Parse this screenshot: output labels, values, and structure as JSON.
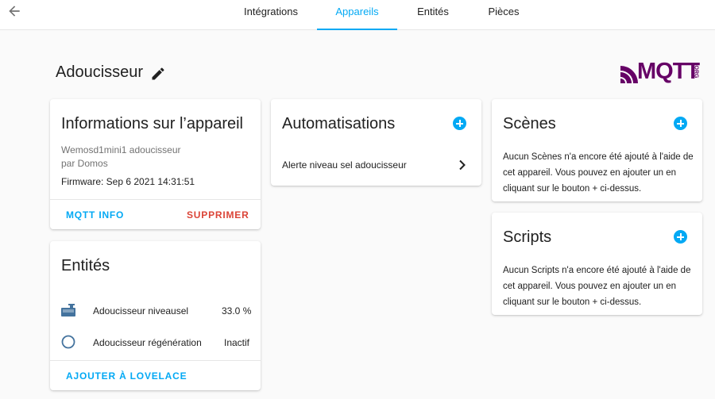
{
  "nav": {
    "back_icon": "arrow-left-icon",
    "tabs": [
      {
        "label": "Intégrations",
        "active": false
      },
      {
        "label": "Appareils",
        "active": true
      },
      {
        "label": "Entités",
        "active": false
      },
      {
        "label": "Pièces",
        "active": false
      }
    ]
  },
  "header": {
    "title": "Adoucisseur",
    "edit_icon": "pencil-icon",
    "logo_text": "MQTT",
    "logo_sub": "ORG"
  },
  "device_info": {
    "title": "Informations sur l’appareil",
    "model": "Wemosd1mini1 adoucisseur",
    "manufacturer": "par Domos",
    "firmware": "Firmware: Sep 6 2021 14:31:51",
    "mqtt_info_label": "MQTT INFO",
    "delete_label": "SUPPRIMER"
  },
  "entities": {
    "title": "Entités",
    "items": [
      {
        "icon": "water-tank-icon",
        "name": "Adoucisseur niveausel",
        "state": "33.0 %"
      },
      {
        "icon": "circle-outline-icon",
        "name": "Adoucisseur régénération",
        "state": "Inactif"
      }
    ],
    "add_label": "AJOUTER À LOVELACE"
  },
  "automations": {
    "title": "Automatisations",
    "items": [
      {
        "name": "Alerte niveau sel adoucisseur"
      }
    ]
  },
  "scenes": {
    "title": "Scènes",
    "text": "Aucun Scènes n'a encore été ajouté à l'aide de cet appareil. Vous pouvez en ajouter un en cliquant sur le bouton + ci-dessus."
  },
  "scripts": {
    "title": "Scripts",
    "text": "Aucun Scripts n'a encore été ajouté à l'aide de cet appareil. Vous pouvez en ajouter un en cliquant sur le bouton + ci-dessus."
  },
  "colors": {
    "accent": "#03a9f4",
    "danger": "#db4437",
    "entity_icon": "#44739e",
    "logo": "#660066"
  }
}
